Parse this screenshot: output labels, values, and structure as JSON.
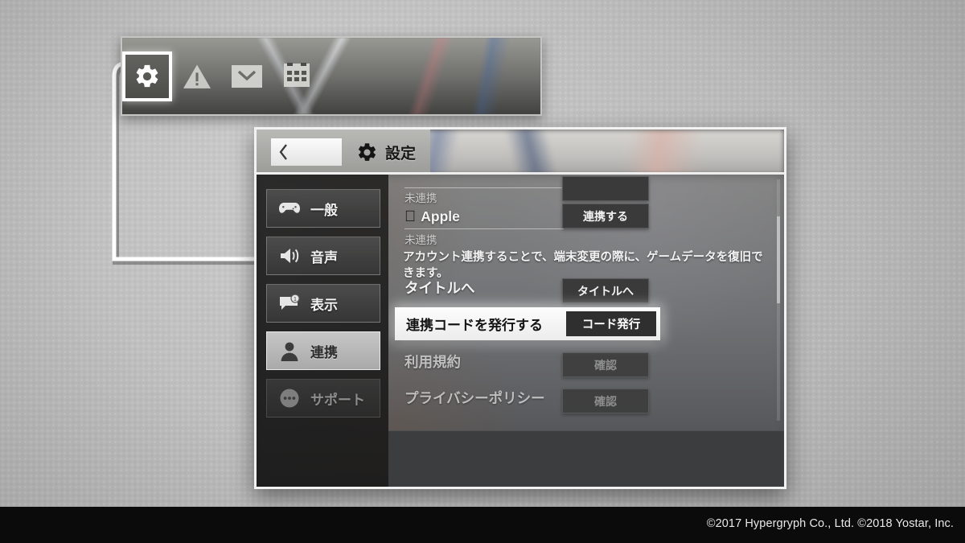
{
  "hud": {
    "icons": [
      {
        "name": "gear-icon",
        "label": "設定",
        "selected": true
      },
      {
        "name": "warning-icon",
        "label": "お知らせ",
        "selected": false
      },
      {
        "name": "mail-icon",
        "label": "メール",
        "selected": false
      },
      {
        "name": "calendar-icon",
        "label": "カレンダー",
        "selected": false
      }
    ]
  },
  "window": {
    "back_label": "",
    "title": "設定",
    "title_icon": "gear-icon"
  },
  "sidebar": {
    "items": [
      {
        "label": "一般",
        "icon": "gamepad-icon",
        "state": "normal"
      },
      {
        "label": "音声",
        "icon": "speaker-icon",
        "state": "normal"
      },
      {
        "label": "表示",
        "icon": "chat-badge-icon",
        "state": "normal"
      },
      {
        "label": "連携",
        "icon": "person-icon",
        "state": "active"
      },
      {
        "label": "サポート",
        "icon": "dots-icon",
        "state": "dim"
      }
    ]
  },
  "content": {
    "partial_row": {
      "status": "未連携"
    },
    "apple_row": {
      "label": "Apple",
      "icon": "apple-icon",
      "button": "連携する",
      "status": "未連携"
    },
    "description": "アカウント連携することで、端末変更の際に、ゲームデータを復旧できます。",
    "rows": [
      {
        "label": "タイトルへ",
        "button": "タイトルへ",
        "faded": false
      },
      {
        "label": "利用規約",
        "button": "確認",
        "faded": true
      },
      {
        "label": "プライバシーポリシー",
        "button": "確認",
        "faded": true
      }
    ],
    "highlighted_row": {
      "label": "連携コードを発行する",
      "button": "コード発行"
    }
  },
  "footer": {
    "copyright": "©2017 Hypergryph Co., Ltd. ©2018 Yostar, Inc."
  },
  "colors": {
    "background": "#bdbdbd",
    "footer_bar": "#0b0b0b",
    "highlight": "#fdfdfd",
    "button_dark": "#3a3a3a",
    "accent_line": "#ffffff"
  }
}
